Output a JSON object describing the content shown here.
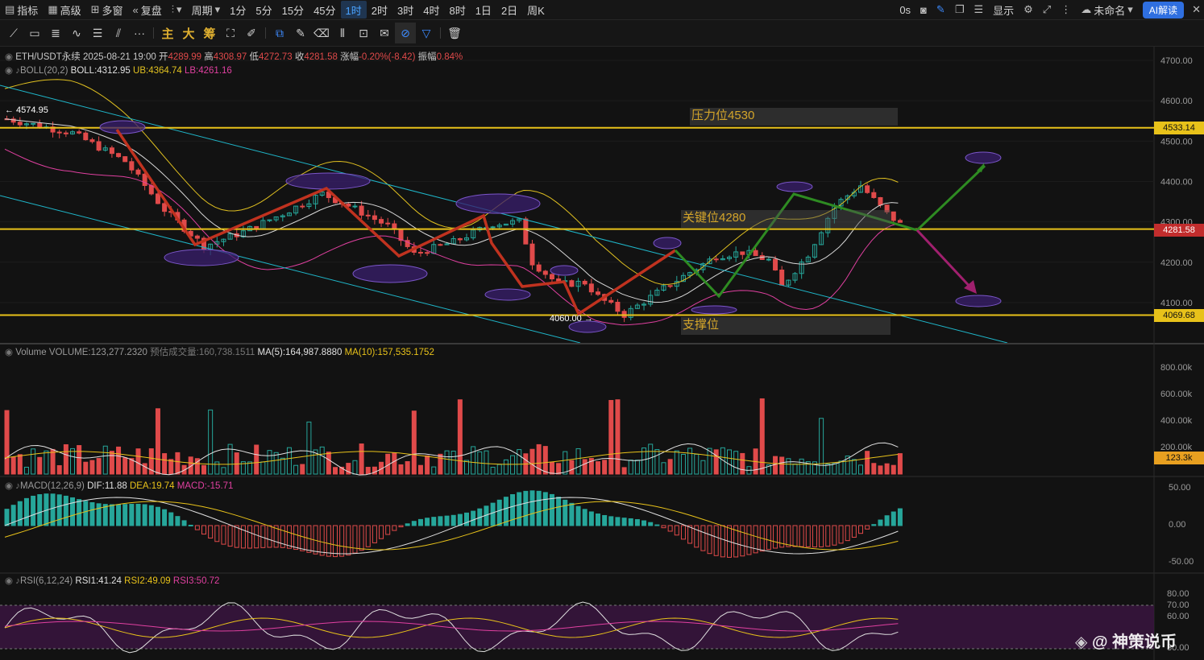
{
  "toolbar": {
    "left": [
      {
        "icon": "indicator-icon",
        "label": "指标"
      },
      {
        "icon": "advanced-icon",
        "label": "高级"
      },
      {
        "icon": "multi-window-icon",
        "label": "多窗"
      },
      {
        "icon": "replay-icon",
        "label": "复盘"
      }
    ],
    "chart_type_icon": "candle-type-icon",
    "period_label": "周期",
    "timeframes": [
      "1分",
      "5分",
      "15分",
      "45分",
      "1时",
      "2时",
      "3时",
      "4时",
      "8时",
      "1日",
      "2日",
      "周K"
    ],
    "active_timeframe": "1时",
    "right": {
      "latency": "0s",
      "display_label": "显示",
      "account_label": "未命名",
      "ai_label": "AI解读"
    }
  },
  "drawing_tools": {
    "icons": [
      "line-tool-icon",
      "rect-tool-icon",
      "fib-tool-icon",
      "wave-tool-icon",
      "parallel-tool-icon",
      "channel-tool-icon",
      "more-tools-icon"
    ],
    "text_tools": [
      "主",
      "大",
      "筹"
    ],
    "extra_icons": [
      "magnet-icon",
      "brush-icon",
      "copy-icon",
      "pencil-icon",
      "eraser-icon",
      "measure-icon",
      "lock-icon",
      "note-icon",
      "link-icon",
      "filter-icon",
      "trash-icon"
    ]
  },
  "main_panel": {
    "symbol_line": {
      "symbol": "ETH/USDT永续",
      "datetime": "2025-08-21 19:00",
      "open_label": "开",
      "open": "4289.99",
      "high_label": "高",
      "high": "4308.97",
      "low_label": "低",
      "low": "4272.73",
      "close_label": "收",
      "close": "4281.58",
      "change_label": "涨幅",
      "change": "-0.20%(-8.42)",
      "amp_label": "振幅",
      "amp": "0.84%"
    },
    "boll": {
      "name": "BOLL(20,2)",
      "mid": "BOLL:4312.95",
      "ub": "UB:4364.74",
      "lb": "LB:4261.16"
    },
    "annotations": {
      "resistance": "压力位4530",
      "key": "关键位4280",
      "support": "支撑位",
      "high_marker": "← 4574.95",
      "low_marker": "4060.00 →"
    },
    "price_axis": [
      "4700.00",
      "4600.00",
      "4500.00",
      "4400.00",
      "4300.00",
      "4200.00",
      "4100.00"
    ],
    "price_tags": {
      "resistance": "4533.14",
      "last": "4281.58",
      "support": "4069.68"
    }
  },
  "volume_panel": {
    "name": "Volume",
    "volume": "VOLUME:123,277.2320",
    "est": "预估成交量:160,738.1511",
    "ma5": "MA(5):164,987.8880",
    "ma10": "MA(10):157,535.1752",
    "axis": [
      "800.00k",
      "600.00k",
      "400.00k",
      "200.00k"
    ],
    "tag": "123.3k"
  },
  "macd_panel": {
    "name": "MACD(12,26,9)",
    "dif": "DIF:11.88",
    "dea": "DEA:19.74",
    "macd": "MACD:-15.71",
    "axis": [
      "50.00",
      "0.00",
      "-50.00"
    ]
  },
  "rsi_panel": {
    "name": "RSI(6,12,24)",
    "rsi1": "RSI1:41.24",
    "rsi2": "RSI2:49.09",
    "rsi3": "RSI3:50.72",
    "axis": [
      "80.00",
      "70.00",
      "60.00",
      "30.00"
    ]
  },
  "watermark": "@ 神策说币",
  "colors": {
    "up": "#26a69a",
    "down": "#e04a4a",
    "yellow": "#e8c21a",
    "boll_mid": "#d8d8d8",
    "boll_ub": "#e0c020",
    "boll_lb": "#e040a0",
    "cyan": "#1fb5c8",
    "accent": "#3d8bff"
  }
}
